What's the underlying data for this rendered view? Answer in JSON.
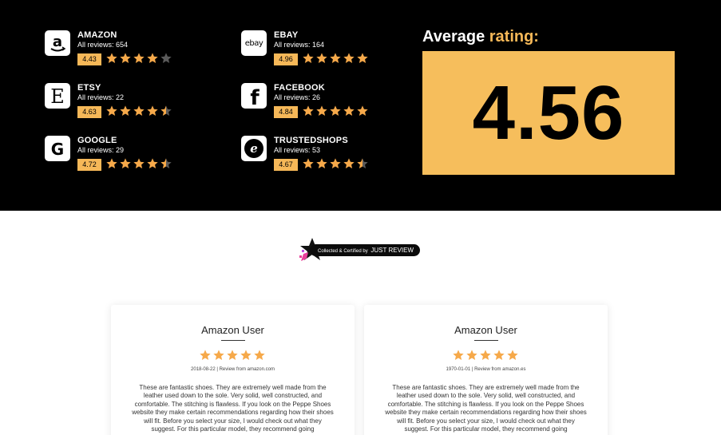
{
  "platforms": [
    {
      "name": "AMAZON",
      "reviews": "All reviews: 654",
      "score": "4.43",
      "logo_icon": "amazon-logo-icon",
      "stars": [
        1,
        1,
        1,
        1,
        0
      ]
    },
    {
      "name": "EBAY",
      "reviews": "All reviews: 164",
      "score": "4.96",
      "logo_icon": "ebay-logo-icon",
      "stars": [
        1,
        1,
        1,
        1,
        1
      ]
    },
    {
      "name": "ETSY",
      "reviews": "All reviews: 22",
      "score": "4.63",
      "logo_icon": "etsy-logo-icon",
      "stars": [
        1,
        1,
        1,
        1,
        0.5
      ]
    },
    {
      "name": "FACEBOOK",
      "reviews": "All reviews: 26",
      "score": "4.84",
      "logo_icon": "facebook-logo-icon",
      "stars": [
        1,
        1,
        1,
        1,
        1
      ]
    },
    {
      "name": "GOOGLE",
      "reviews": "All reviews: 29",
      "score": "4.72",
      "logo_icon": "google-logo-icon",
      "stars": [
        1,
        1,
        1,
        1,
        0.5
      ]
    },
    {
      "name": "TRUSTEDSHOPS",
      "reviews": "All reviews: 53",
      "score": "4.67",
      "logo_icon": "trustedshops-logo-icon",
      "stars": [
        1,
        1,
        1,
        1,
        0.5
      ]
    }
  ],
  "logo_glyphs": {
    "amazon": "a",
    "ebay": "ebay",
    "etsy": "E",
    "facebook": "f",
    "google": "G",
    "trustedshops": "e"
  },
  "average": {
    "title_prefix": "Average ",
    "title_highlight": "rating:",
    "value": "4.56"
  },
  "badge": {
    "prefix": "Collected & Certified by",
    "brand": "JUST REVIEW"
  },
  "reviews": [
    {
      "name": "Amazon User",
      "meta": "2018-08-22 | Review from amazon.com",
      "stars": 5,
      "text": "These are fantastic shoes. They are extremely well made from the leather used down to the sole. Very solid, well constructed, and comfortable. The stitching is flawless. If you look on the Peppe Shoes website they make certain recommendations regarding how their shoes will fit. Before you select your size, I would check out what they suggest. For this particular model, they recommend going"
    },
    {
      "name": "Amazon User",
      "meta": "1970-01-01 | Review from amazon.es",
      "stars": 5,
      "text": "These are fantastic shoes. They are extremely well made from the leather used down to the sole. Very solid, well constructed, and comfortable. The stitching is flawless. If you look on the Peppe Shoes website they make certain recommendations regarding how their shoes will fit. Before you select your size, I would check out what they suggest. For this particular model, they recommend going"
    }
  ],
  "colors": {
    "star": "#f6a94a",
    "star_empty": "#5a5a5a",
    "accent": "#f6be5c",
    "score_bg": "#f6b858"
  }
}
